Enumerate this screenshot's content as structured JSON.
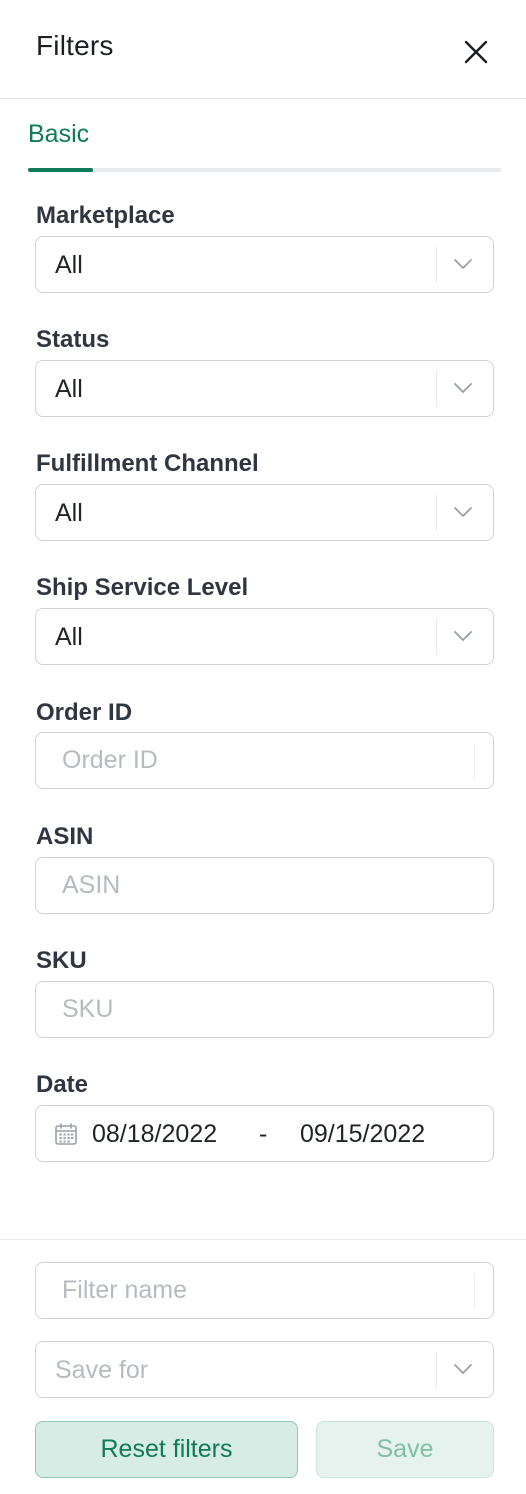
{
  "header": {
    "title": "Filters",
    "close_icon": "close-icon"
  },
  "tabs": [
    {
      "label": "Basic",
      "active": true
    }
  ],
  "accent_color": "#0e7a57",
  "fields": {
    "marketplace": {
      "label": "Marketplace",
      "value": "All"
    },
    "status": {
      "label": "Status",
      "value": "All"
    },
    "fulfillment_channel": {
      "label": "Fulfillment Channel",
      "value": "All"
    },
    "ship_service_level": {
      "label": "Ship Service Level",
      "value": "All"
    },
    "order_id": {
      "label": "Order ID",
      "placeholder": "Order ID",
      "value": ""
    },
    "asin": {
      "label": "ASIN",
      "placeholder": "ASIN",
      "value": ""
    },
    "sku": {
      "label": "SKU",
      "placeholder": "SKU",
      "value": ""
    },
    "date": {
      "label": "Date",
      "start": "08/18/2022",
      "separator": "-",
      "end": "09/15/2022",
      "icon": "calendar-icon"
    }
  },
  "footer": {
    "filter_name": {
      "placeholder": "Filter name",
      "value": ""
    },
    "save_for": {
      "placeholder": "Save for"
    },
    "reset_label": "Reset filters",
    "save_label": "Save"
  }
}
